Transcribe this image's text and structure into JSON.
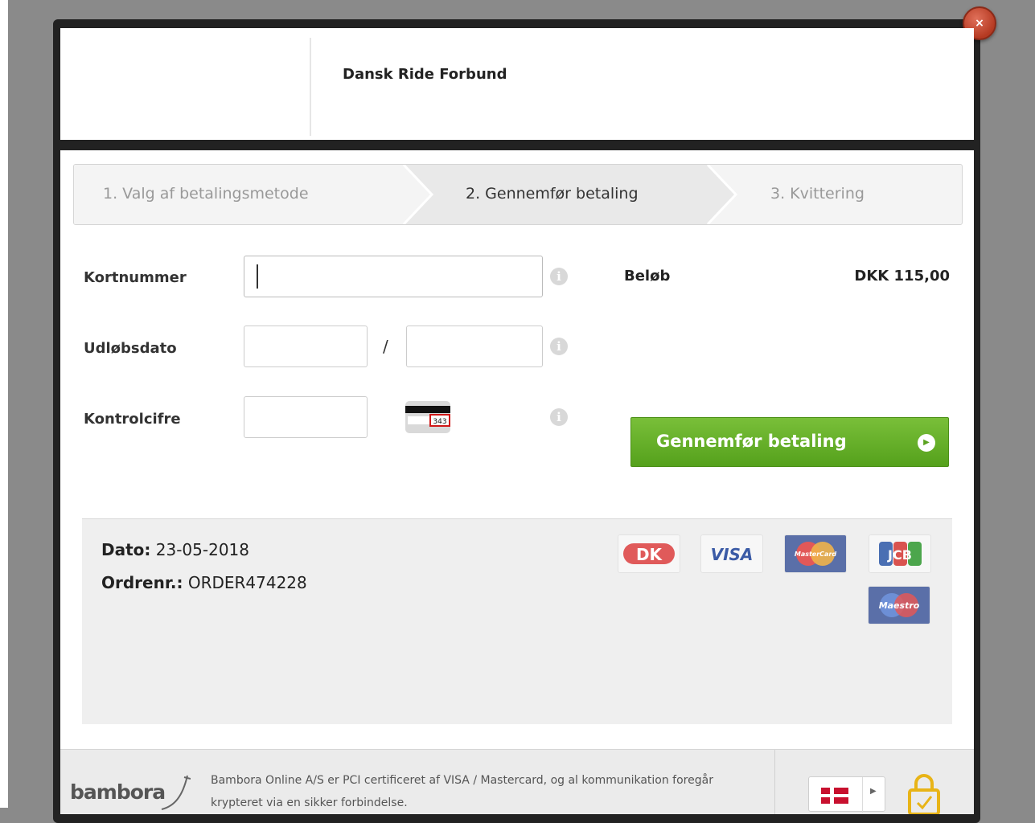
{
  "window": {
    "close_label": "×"
  },
  "header": {
    "merchant_name": "Dansk Ride Forbund"
  },
  "steps": [
    {
      "label": "1. Valg af betalingsmetode",
      "active": false
    },
    {
      "label": "2. Gennemfør betaling",
      "active": true
    },
    {
      "label": "3. Kvittering",
      "active": false
    }
  ],
  "form": {
    "card_number": {
      "label": "Kortnummer",
      "value": ""
    },
    "expiry": {
      "label": "Udløbsdato",
      "month": "",
      "year": "",
      "separator": "/"
    },
    "cvc": {
      "label": "Kontrolcifre",
      "value": "",
      "example": "343"
    },
    "info_glyph": "i"
  },
  "summary": {
    "amount_label": "Beløb",
    "amount_value": "DKK 115,00"
  },
  "pay_button": {
    "label": "Gennemfør betaling"
  },
  "order_info": {
    "date_label": "Dato:",
    "date_value": "23-05-2018",
    "order_label": "Ordrenr.:",
    "order_value": "ORDER474228"
  },
  "card_logos": [
    {
      "name": "DK",
      "label": "DK"
    },
    {
      "name": "VISA",
      "label": "VISA"
    },
    {
      "name": "MasterCard",
      "label": "MasterCard"
    },
    {
      "name": "JCB",
      "label": "JCB"
    },
    {
      "name": "Maestro",
      "label": "Maestro"
    }
  ],
  "footer": {
    "logo_text": "bambora",
    "security_text": "Bambora Online A/S er PCI certificeret af VISA / Mastercard, og al kommunikation foregår krypteret via en sikker forbindelse.",
    "language": "Danish"
  },
  "colors": {
    "pay_button": "#5ba321",
    "close_button": "#c9482f",
    "overlay": "#8a8a8a"
  }
}
